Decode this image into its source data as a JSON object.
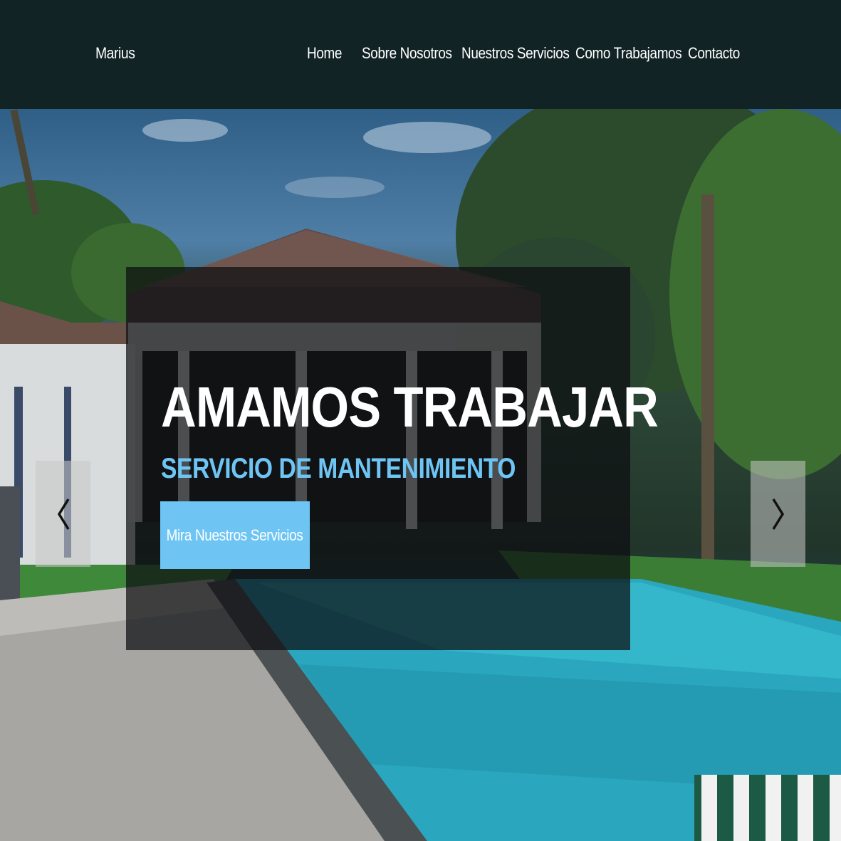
{
  "navbar": {
    "brand": "Marius",
    "links": [
      {
        "label": "Home"
      },
      {
        "label": "Sobre Nosotros"
      },
      {
        "label": "Nuestros Servicios"
      },
      {
        "label": "Como Trabajamos"
      },
      {
        "label": "Contacto"
      }
    ]
  },
  "hero": {
    "title": "AMAMOS TRABAJAR",
    "subtitle": "SERVICIO DE MANTENIMIENTO",
    "cta_label": "Mira Nuestros Servicios",
    "prev_icon": "chevron-left-icon",
    "next_icon": "chevron-right-icon"
  },
  "colors": {
    "navbar_bg": "#122326",
    "accent": "#6ec5f4",
    "text": "#ffffff"
  }
}
